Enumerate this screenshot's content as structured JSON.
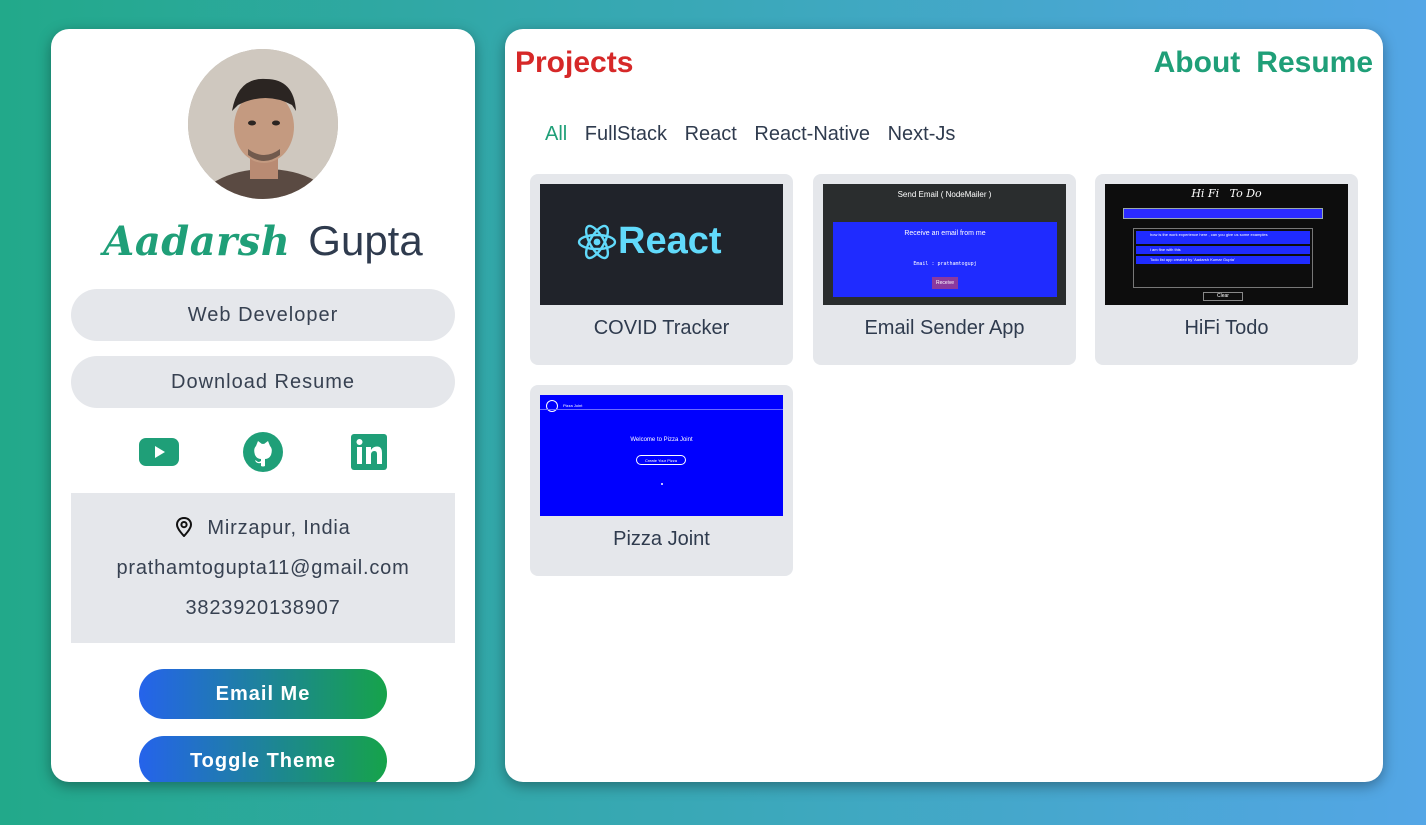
{
  "profile": {
    "first_name": "Aadarsh",
    "last_name": "Gupta",
    "role": "Web Developer",
    "download_label": "Download Resume",
    "socials": [
      {
        "name": "youtube-icon"
      },
      {
        "name": "github-icon"
      },
      {
        "name": "linkedin-icon"
      }
    ],
    "location": "Mirzapur, India",
    "email": "prathamtogupta11@gmail.com",
    "phone": "3823920138907",
    "email_btn": "Email Me",
    "theme_btn": "Toggle Theme"
  },
  "header": {
    "title": "Projects",
    "nav": [
      "About",
      "Resume"
    ]
  },
  "filters": [
    "All",
    "FullStack",
    "React",
    "React-Native",
    "Next-Js"
  ],
  "projects": [
    {
      "title": "COVID Tracker",
      "thumb_text": "React"
    },
    {
      "title": "Email Sender App",
      "thumb_title": "Send Email ( NodeMailer )",
      "thumb_heading": "Receive an email from me",
      "thumb_field": "Email :  prathamtogupj",
      "thumb_btn": "Receive"
    },
    {
      "title": "HiFi Todo",
      "thumb_title": "Hi Fi   To Do",
      "thumb_items": [
        "how is the work experience here , can you give us some examples",
        "i am fine with this",
        "Todo list app created by 'Aadarsh Kumar Gupta'"
      ],
      "thumb_btn": "Clear"
    },
    {
      "title": "Pizza Joint",
      "thumb_nav": "Pizza Joint",
      "thumb_heading": "Welcome to Pizza Joint",
      "thumb_btn": "Create Your Pizza"
    }
  ],
  "colors": {
    "accent_green": "#1f9f78",
    "accent_red": "#d62828",
    "pill_bg": "#e5e7eb"
  }
}
